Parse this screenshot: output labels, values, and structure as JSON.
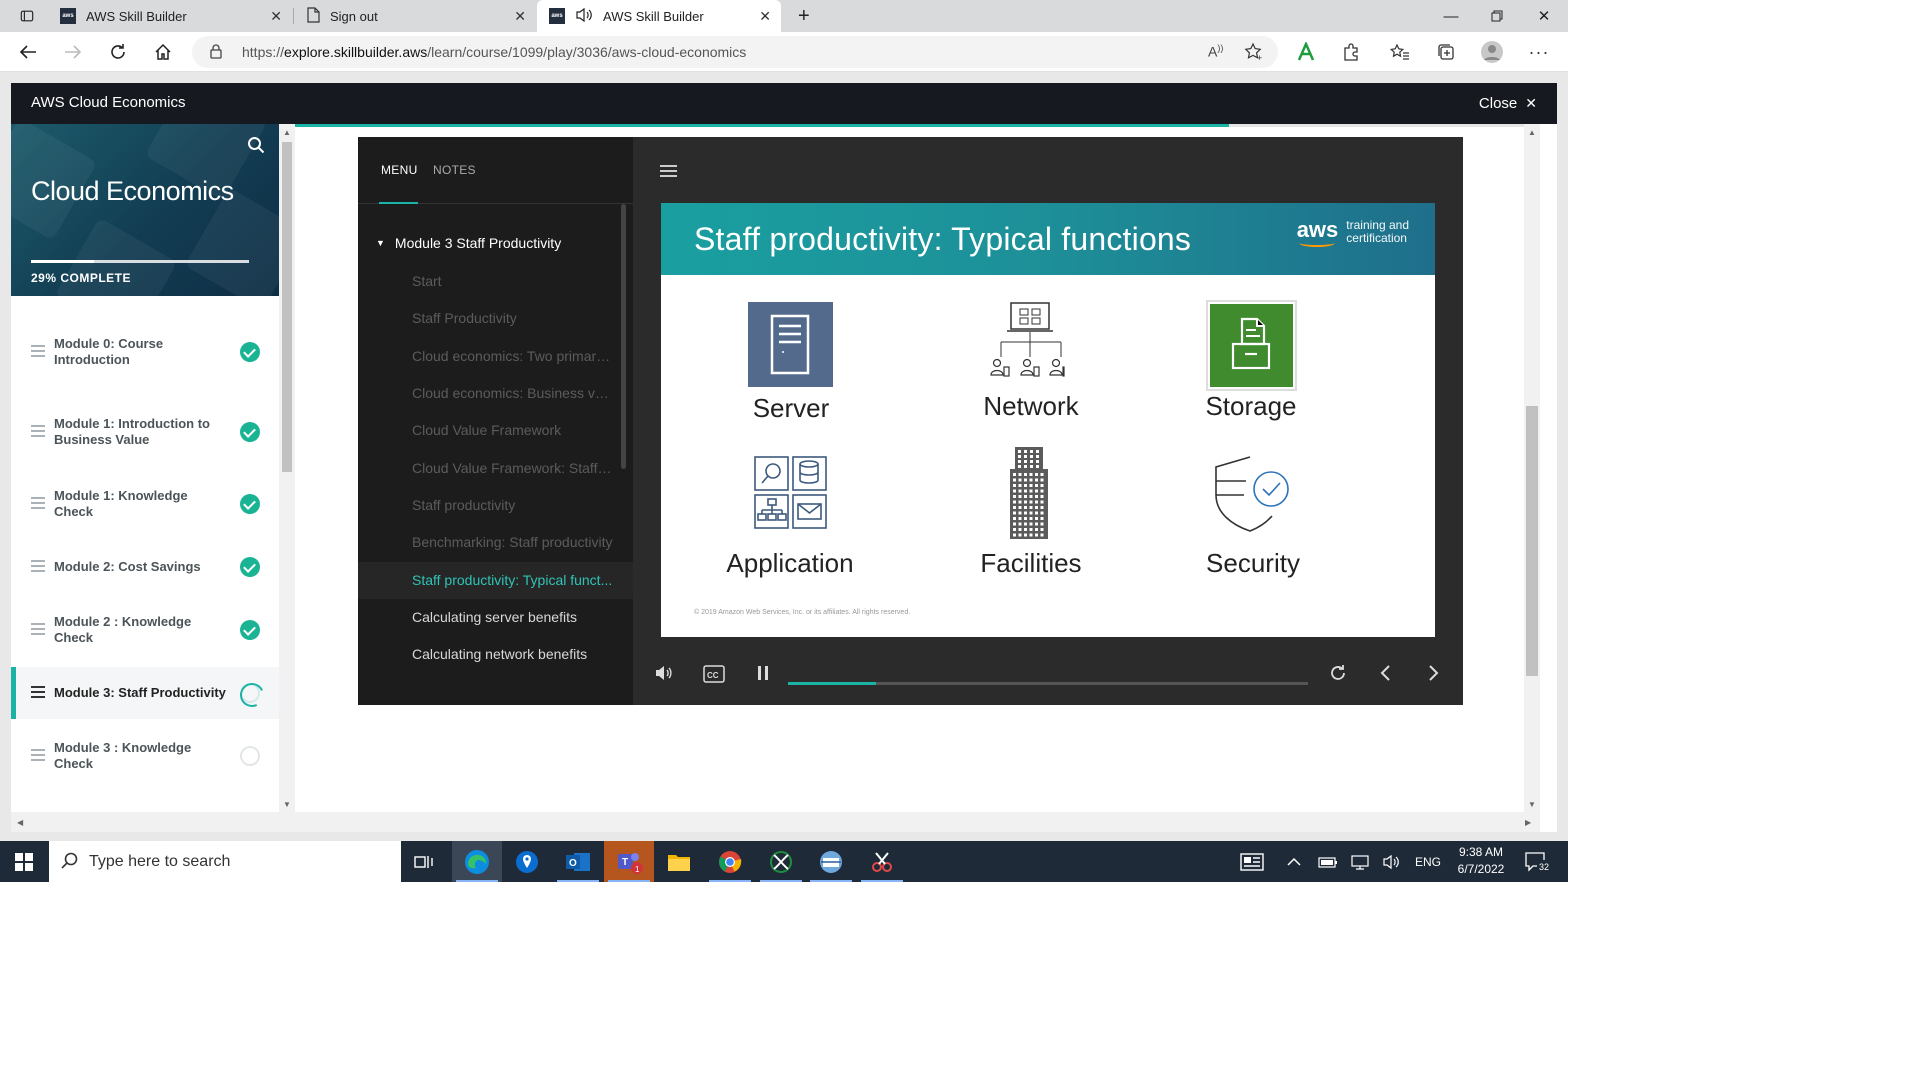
{
  "browser": {
    "tabs": [
      {
        "title": "AWS Skill Builder",
        "favicon": "aws-icon",
        "active": false
      },
      {
        "title": "Sign out",
        "favicon": "page-icon",
        "active": false
      },
      {
        "title": "AWS Skill Builder",
        "favicon": "aws-icon",
        "active": true,
        "audio": true
      }
    ],
    "url_prefix": "https://",
    "url_domain": "explore.skillbuilder.aws",
    "url_path": "/learn/course/1099/play/3036/aws-cloud-economics"
  },
  "app": {
    "title": "AWS Cloud Economics",
    "close_label": "Close"
  },
  "course": {
    "name": "Cloud Economics",
    "progress_percent": 29,
    "progress_label": "29% COMPLETE",
    "modules": [
      {
        "label": "Module 0: Course Introduction",
        "status": "done"
      },
      {
        "label": "Module 1: Introduction to Business Value",
        "status": "done"
      },
      {
        "label": "Module 1: Knowledge Check",
        "status": "done"
      },
      {
        "label": "Module 2: Cost Savings",
        "status": "done"
      },
      {
        "label": "Module 2 : Knowledge Check",
        "status": "done"
      },
      {
        "label": "Module 3: Staff Productivity",
        "status": "in-progress"
      },
      {
        "label": "Module 3 : Knowledge Check",
        "status": "todo"
      }
    ]
  },
  "player": {
    "tabs": {
      "menu": "MENU",
      "notes": "NOTES"
    },
    "section": "Module 3 Staff Productivity",
    "items": [
      "Start",
      "Staff Productivity",
      "Cloud economics: Two primary ...",
      "Cloud economics: Business value",
      "Cloud Value Framework",
      "Cloud Value Framework: Staff p...",
      "Staff productivity",
      "Benchmarking: Staff productivity",
      "Staff productivity: Typical funct...",
      "Calculating server benefits",
      "Calculating network benefits"
    ],
    "current_index": 8,
    "seek_progress": 0.17
  },
  "slide": {
    "title": "Staff productivity: Typical functions",
    "logo_text": "aws",
    "logo_tag_line1": "training and",
    "logo_tag_line2": "certification",
    "functions": [
      "Server",
      "Network",
      "Storage",
      "Application",
      "Facilities",
      "Security"
    ],
    "footer": "© 2019 Amazon Web Services, Inc. or its affiliates. All rights reserved.",
    "colors": {
      "banner": "#1d8f98",
      "server": "#546a8c",
      "storage": "#3f8b2e"
    }
  },
  "taskbar": {
    "search_placeholder": "Type here to search",
    "language": "ENG",
    "time": "9:38 AM",
    "date": "6/7/2022",
    "notification_count": "32"
  }
}
